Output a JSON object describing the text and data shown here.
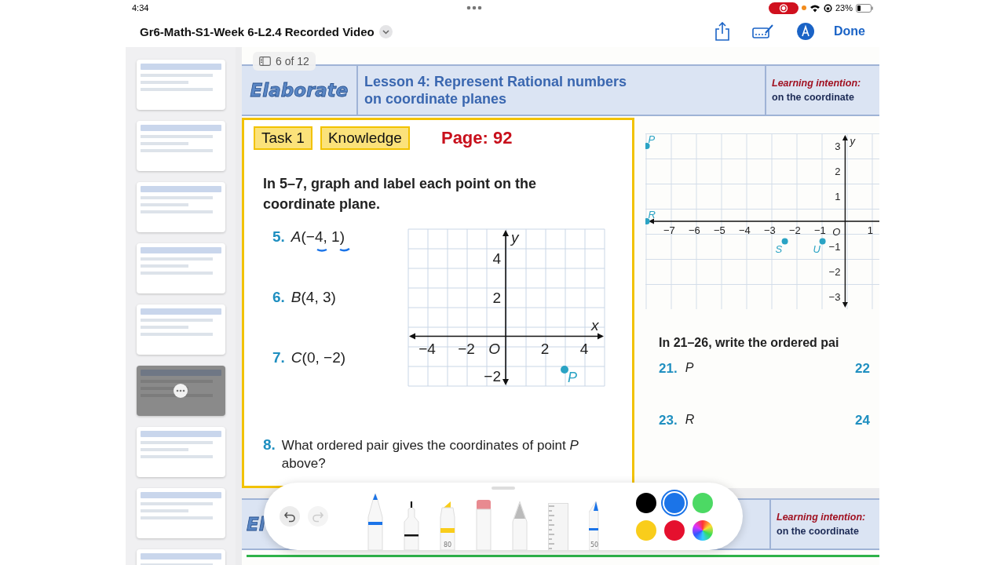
{
  "status_bar": {
    "time": "4:34",
    "battery": "23%"
  },
  "header": {
    "title": "Gr6-Math-S1-Week 6-L2.4 Recorded Video",
    "done": "Done"
  },
  "thumbnails": [
    {
      "selected": false
    },
    {
      "selected": false
    },
    {
      "selected": false
    },
    {
      "selected": false
    },
    {
      "selected": false
    },
    {
      "selected": true
    },
    {
      "selected": false
    },
    {
      "selected": false
    },
    {
      "selected": false
    }
  ],
  "page_indicator": "6 of 12",
  "slide": {
    "section": "Elaborate",
    "lesson_lines": [
      "Lesson 4: Represent Rational numbers",
      "on coordinate planes"
    ],
    "intention_title": "Learning intention:",
    "intention_text": "on the coordinate"
  },
  "tags": [
    "Task 1",
    "Knowledge"
  ],
  "page_ref": "Page: 92",
  "instruction": "In **5–7**, graph and label each point on the coordinate plane.",
  "exercises": [
    {
      "number": "5.",
      "text": "*A*(−4, 1)",
      "inked": true
    },
    {
      "number": "6.",
      "text": "*B*(4, 3)",
      "inked": false
    },
    {
      "number": "7.",
      "text": "*C*(0, −2)",
      "inked": false
    }
  ],
  "graph_1": {
    "x_label": "x",
    "y_label": "y",
    "origin": "O",
    "x_ticks": [
      "−4",
      "−2",
      "2",
      "4"
    ],
    "y_ticks": [
      "4",
      "2",
      "−2"
    ],
    "points": [
      {
        "label": "P"
      }
    ]
  },
  "question_8": {
    "number": "8.",
    "text": "What ordered pair gives the coordinates of point *P* above?"
  },
  "graph_2": {
    "y_label": "y",
    "origin": "O",
    "x_ticks": [
      "−7",
      "−6",
      "−5",
      "−4",
      "−3",
      "−2",
      "−1",
      "1"
    ],
    "y_ticks": [
      "3",
      "2",
      "1",
      "−1",
      "−2",
      "−3"
    ],
    "points": [
      {
        "label": "P"
      },
      {
        "label": "R"
      },
      {
        "label": "S"
      },
      {
        "label": "U"
      }
    ]
  },
  "right_instruction": "In **21–26**, write the ordered pai",
  "answers": [
    {
      "number": "21.",
      "text": "*P*"
    },
    {
      "number": "22"
    },
    {
      "number": "23.",
      "text": "*R*"
    },
    {
      "number": "24"
    }
  ],
  "toolbar": {
    "undo": {
      "disabled": false
    },
    "redo": {
      "disabled": true
    },
    "tools": [
      {
        "kind": "pen"
      },
      {
        "kind": "fineliner"
      },
      {
        "kind": "marker",
        "label": "80"
      },
      {
        "kind": "eraser"
      },
      {
        "kind": "pencil"
      },
      {
        "kind": "ruler"
      },
      {
        "kind": "crayon",
        "label": "50"
      }
    ],
    "colors": [
      {
        "kind": "swatch",
        "color": "#000000",
        "selected": false
      },
      {
        "kind": "swatch",
        "color": "#1b74e8",
        "selected": true
      },
      {
        "kind": "swatch",
        "color": "#4cd964",
        "selected": false
      },
      {
        "kind": "swatch",
        "color": "#f9cd1b",
        "selected": false
      },
      {
        "kind": "swatch",
        "color": "#e5102e",
        "selected": false
      },
      {
        "kind": "wheel",
        "selected": false
      }
    ]
  },
  "next_slide": {
    "section": "El",
    "intention_title": "Learning intention:",
    "intention_text": "on the coordinate"
  }
}
